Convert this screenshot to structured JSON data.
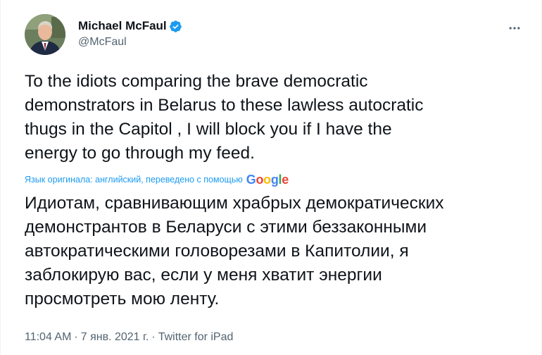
{
  "author": {
    "display_name": "Michael McFaul",
    "handle": "@McFaul",
    "verified_icon": "verified-badge-icon"
  },
  "tweet": {
    "text_en": "To the idiots comparing the brave democratic\ndemonstrators in Belarus to these lawless autocratic\nthugs in the Capitol , I will block you if I have the\nenergy to go through my feed.",
    "translation_note": "Язык оригинала: английский, переведено с помощью",
    "translation_provider": {
      "G": "G",
      "o1": "o",
      "o2": "o",
      "g": "g",
      "l": "l",
      "e": "e"
    },
    "text_ru": "Идиотам, сравнивающим храбрых демократических\nдемонстрантов в Беларуси с этими беззаконными\nавтократическими головорезами в Капитолии, я\nзаблокирую вас, если у меня хватит энергии\nпросмотреть мою ленту."
  },
  "meta": {
    "time": "11:04 AM",
    "separator": "·",
    "date": "7 янв. 2021 г.",
    "source": "Twitter for iPad"
  },
  "colors": {
    "verified": "#1d9bf0",
    "link": "#1d9bf0",
    "secondary_text": "#536471",
    "google_blue": "#4285F4",
    "google_red": "#EA4335",
    "google_yellow": "#FBBC05",
    "google_green": "#34A853"
  },
  "icons": [
    "more-options-icon",
    "verified-badge-icon",
    "avatar"
  ]
}
